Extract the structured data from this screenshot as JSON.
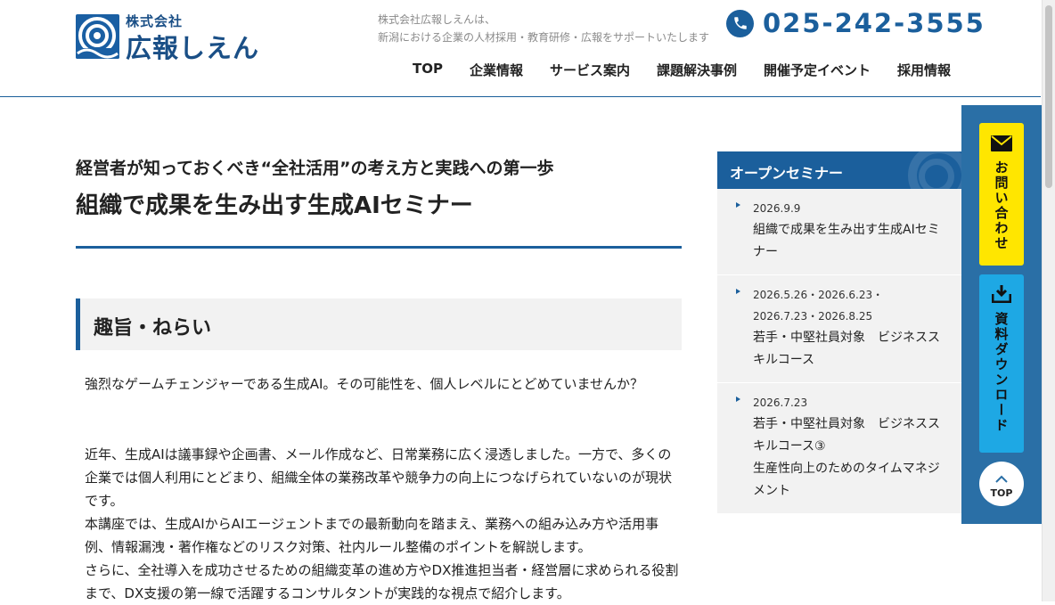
{
  "header": {
    "logo": {
      "small": "株式会社",
      "big": "広報しえん"
    },
    "tagline": [
      "株式会社広報しえんは、",
      "新潟における企業の人材採用・教育研修・広報をサポートいたします"
    ],
    "phone": "025-242-3555",
    "nav": [
      "TOP",
      "企業情報",
      "サービス案内",
      "課題解決事例",
      "開催予定イベント",
      "採用情報"
    ]
  },
  "main": {
    "subtitle": "経営者が知っておくべき“全社活用”の考え方と実践への第一歩",
    "title": "組織で成果を生み出す生成AIセミナー",
    "section_heading": "趣旨・ねらい",
    "paragraph1": "強烈なゲームチェンジャーである生成AI。その可能性を、個人レベルにとどめていませんか？",
    "paragraph2": "近年、生成AIは議事録や企画書、メール作成など、日常業務に広く浸透しました。一方で、多くの企業では個人利用にとどまり、組織全体の業務改革や競争力の向上につなげられていないのが現状です。\n本講座では、生成AIからAIエージェントまでの最新動向を踏まえ、業務への組み込み方や活用事例、情報漏洩・著作権などのリスク対策、社内ルール整備のポイントを解説します。\nさらに、全社導入を成功させるための組織変革の進め方やDX推進担当者・経営層に求められる役割まで、DX支援の第一線で活躍するコンサルタントが実践的な視点で紹介します。"
  },
  "sidebar": {
    "heading": "オープンセミナー",
    "items": [
      {
        "date": "2026.9.9",
        "name": "組織で成果を生み出す生成AIセミナー"
      },
      {
        "date": "2026.5.26・2026.6.23・2026.7.23・2026.8.25",
        "name": "若手・中堅社員対象　ビジネススキルコース"
      },
      {
        "date": "2026.7.23",
        "name": "若手・中堅社員対象　ビジネススキルコース③\n生産性向上のためのタイムマネジメント"
      }
    ]
  },
  "floating": {
    "contact": "お問い合わせ",
    "download": "資料ダウンロード",
    "top": "TOP"
  },
  "colors": {
    "brand_blue": "#1b5f9c",
    "contact_yellow": "#ffe600",
    "download_cyan": "#1ea8e4"
  },
  "icons": [
    "logo-mark",
    "phone-icon",
    "mail-icon",
    "download-icon",
    "chevron-up-icon"
  ]
}
